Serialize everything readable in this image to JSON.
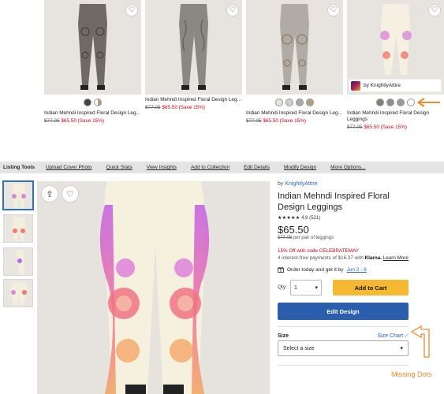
{
  "grid": {
    "cards": [
      {
        "title": "Indian Mehndi Inspired Floral Design Leg...",
        "old_price": "$77.05",
        "price": "$65.50",
        "save": "(Save 15%)",
        "swatch_colors": [
          "#444444",
          "#b39a7e"
        ]
      },
      {
        "title": "Indian Mehndi Inspired Floral Design Leggings",
        "old_price": "$77.05",
        "price": "$65.50",
        "save": "(Save 15%)",
        "swatch_colors": []
      },
      {
        "title": "Indian Mehndi Inspired Floral Design Leg...",
        "old_price": "$77.05",
        "price": "$65.50",
        "save": "(Save 15%)",
        "swatch_colors": [
          "#e8e3d6",
          "#cfcfcf",
          "#a9a9a9",
          "#b39e84"
        ]
      },
      {
        "title": "Indian Mehndi Inspired Floral Design Leggings",
        "old_price": "$77.05",
        "price": "$65.50",
        "save": "(Save 15%)",
        "seller": "by KnightlyAttire",
        "swatch_colors": [
          "#8b7d74",
          "#8c8c8c",
          "#9a9a9a",
          "#ffffff"
        ]
      }
    ]
  },
  "toolbar": {
    "label": "Listing Tools",
    "links": [
      "Upload Cover Photo",
      "Quick Stats",
      "View Insights",
      "Add to Collection",
      "Edit Details",
      "Modify Design",
      "More Options..."
    ]
  },
  "product": {
    "by_prefix": "by ",
    "seller": "KnightlyAttire",
    "title": "Indian Mehndi Inspired Floral Design Leggings",
    "stars": "★★★★★",
    "rating": "4.8",
    "reviews": "(521)",
    "price": "$65.50",
    "old_price": "$77.05",
    "per_unit": "per pair of leggings",
    "promo": "15% Off with code CELEBRATEMAY",
    "klarna_text": "4 interest-free payments of $16.37 with",
    "klarna_brand": "Klarna.",
    "learn_more": "Learn More",
    "order_text": "Order today and get it by",
    "order_date": "Jun 2 - 8",
    "qty_label": "Qty:",
    "qty_value": "1",
    "add_to_cart": "Add to Cart",
    "edit_design": "Edit Design",
    "size_label": "Size",
    "size_chart": "Size Chart",
    "size_placeholder": "Select a size"
  },
  "annotation": {
    "text": "Missing Dots",
    "color": "#ee8a2c"
  }
}
